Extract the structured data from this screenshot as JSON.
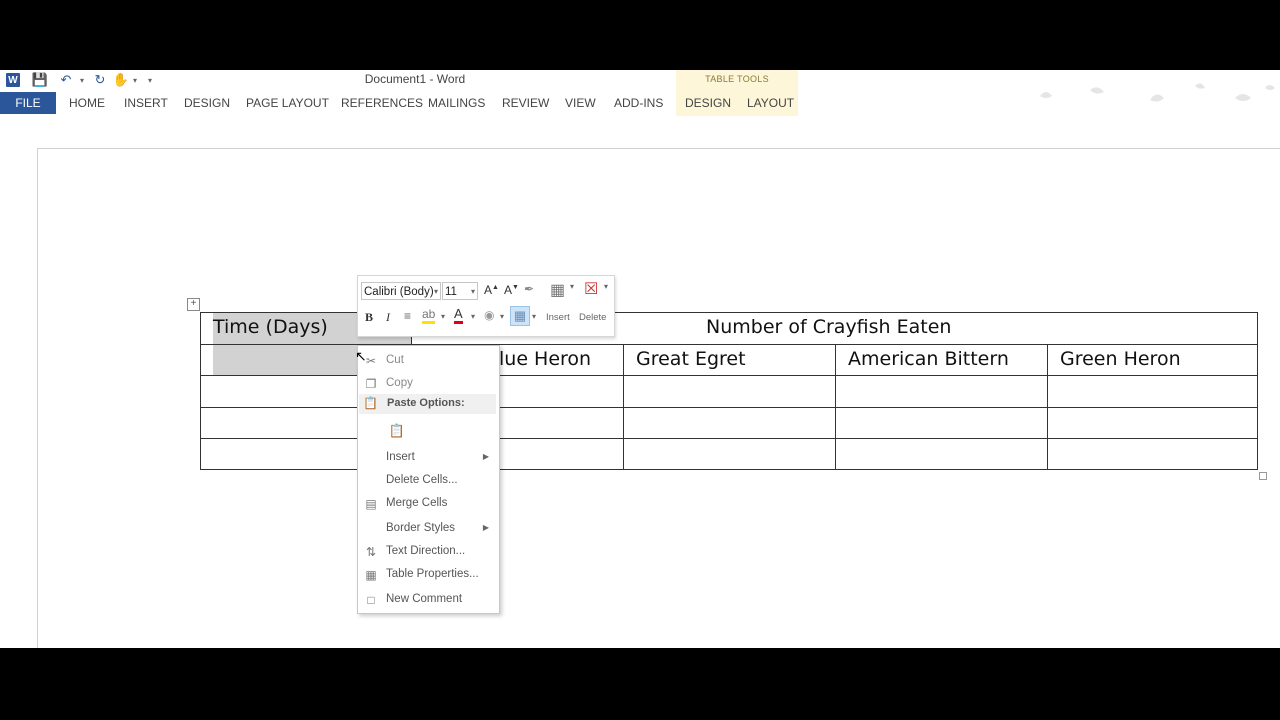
{
  "window": {
    "title": "Document1 - Word"
  },
  "quick_access": {
    "icons": [
      "word-logo-icon",
      "save-icon",
      "undo-icon",
      "redo-icon",
      "touch-mode-icon",
      "customize-icon"
    ],
    "word_logo_text": "W"
  },
  "ribbon": {
    "contextual_group": "TABLE TOOLS",
    "tabs": [
      "FILE",
      "HOME",
      "INSERT",
      "DESIGN",
      "PAGE LAYOUT",
      "REFERENCES",
      "MAILINGS",
      "REVIEW",
      "VIEW",
      "ADD-INS",
      "DESIGN",
      "LAYOUT"
    ],
    "accent_color": "#2b579a"
  },
  "table": {
    "header_row1": {
      "col1": "Time (Days)",
      "span": "Number of Crayfish Eaten"
    },
    "header_row2": [
      "Blue Heron",
      "Great Egret",
      "American Bittern",
      "Green Heron"
    ],
    "partial_visible": "lue Heron"
  },
  "mini_toolbar": {
    "font": "Calibri (Body)",
    "size": "11",
    "bold": "B",
    "italic": "I",
    "insert_label": "Insert",
    "delete_label": "Delete"
  },
  "context_menu": {
    "cut": "Cut",
    "copy": "Copy",
    "paste_options": "Paste Options:",
    "insert": "Insert",
    "delete_cells": "Delete Cells...",
    "merge_cells": "Merge Cells",
    "border_styles": "Border Styles",
    "text_direction": "Text Direction...",
    "table_properties": "Table Properties...",
    "new_comment": "New Comment"
  }
}
